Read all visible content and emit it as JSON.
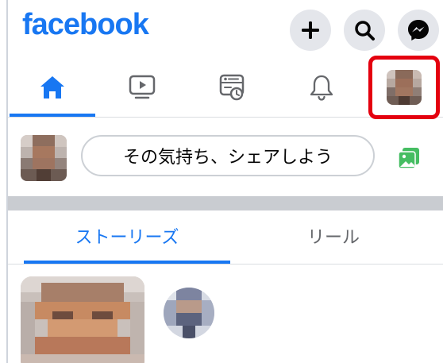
{
  "app": {
    "logo_text": "facebook",
    "brand_color": "#1877f2",
    "highlight_color": "#e4000f"
  },
  "header": {
    "actions": [
      {
        "icon": "plus-icon"
      },
      {
        "icon": "search-icon"
      },
      {
        "icon": "messenger-icon"
      }
    ]
  },
  "nav": {
    "tabs": [
      {
        "icon": "home-icon",
        "active": true
      },
      {
        "icon": "video-icon",
        "active": false
      },
      {
        "icon": "feeds-icon",
        "active": false
      },
      {
        "icon": "bell-icon",
        "active": false
      },
      {
        "icon": "profile-avatar",
        "active": false,
        "highlighted": true
      }
    ]
  },
  "composer": {
    "placeholder": "その気持ち、シェアしよう",
    "photo_icon": "photo-icon"
  },
  "stories": {
    "tabs": [
      {
        "label": "ストーリーズ",
        "active": true
      },
      {
        "label": "リール",
        "active": false
      }
    ]
  }
}
